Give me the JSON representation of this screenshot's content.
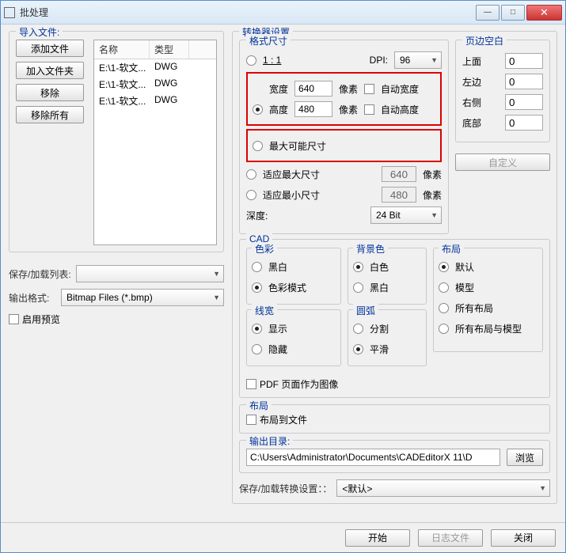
{
  "window": {
    "title": "批处理"
  },
  "import": {
    "legend": "导入文件:",
    "add_file": "添加文件",
    "add_folder": "加入文件夹",
    "remove": "移除",
    "remove_all": "移除所有",
    "col_name": "名称",
    "col_type": "类型",
    "rows": [
      {
        "name": "E:\\1-软文...",
        "type": "DWG"
      },
      {
        "name": "E:\\1-软文...",
        "type": "DWG"
      },
      {
        "name": "E:\\1-软文...",
        "type": "DWG"
      }
    ]
  },
  "save_list": {
    "label": "保存/加载列表:",
    "value": ""
  },
  "out_format": {
    "label": "输出格式:",
    "value": "Bitmap Files (*.bmp)"
  },
  "preview": {
    "label": "启用预览"
  },
  "converter": {
    "legend": "转换器设置",
    "format_size": "格式尺寸",
    "one_to_one": "1 : 1",
    "dpi_label": "DPI:",
    "dpi_value": "96",
    "width_label": "宽度",
    "width_value": "640",
    "width_unit": "像素",
    "auto_width": "自动宽度",
    "height_label": "高度",
    "height_value": "480",
    "height_unit": "像素",
    "auto_height": "自动高度",
    "max_possible": "最大可能尺寸",
    "fit_max": "适应最大尺寸",
    "fit_max_value": "640",
    "fit_max_unit": "像素",
    "fit_min": "适应最小尺寸",
    "fit_min_value": "480",
    "fit_min_unit": "像素",
    "depth_label": "深度:",
    "depth_value": "24 Bit",
    "margins": {
      "legend": "页边空白",
      "top": "上面",
      "left": "左边",
      "right": "右侧",
      "bottom": "底部",
      "value": "0",
      "custom": "自定义"
    }
  },
  "cad": {
    "legend": "CAD",
    "color": {
      "legend": "色彩",
      "bw": "黑白",
      "color_mode": "色彩模式"
    },
    "bg": {
      "legend": "背景色",
      "white": "白色",
      "black": "黑白"
    },
    "linew": {
      "legend": "线宽",
      "show": "显示",
      "hide": "隐藏"
    },
    "arc": {
      "legend": "圆弧",
      "split": "分割",
      "smooth": "平滑"
    },
    "layout": {
      "legend": "布局",
      "default": "默认",
      "model": "模型",
      "all": "所有布局",
      "all_model": "所有布局与模型"
    },
    "pdf_as_image": "PDF 页面作为图像"
  },
  "layout_group": {
    "legend": "布局",
    "to_file": "布局到文件"
  },
  "outdir": {
    "label": "输出目录:",
    "value": "C:\\Users\\Administrator\\Documents\\CADEditorX 11\\D",
    "browse": "浏览"
  },
  "save_convert": {
    "label": "保存/加载转换设置：：",
    "value": "<默认>"
  },
  "footer": {
    "start": "开始",
    "log": "日志文件",
    "close": "关闭"
  }
}
